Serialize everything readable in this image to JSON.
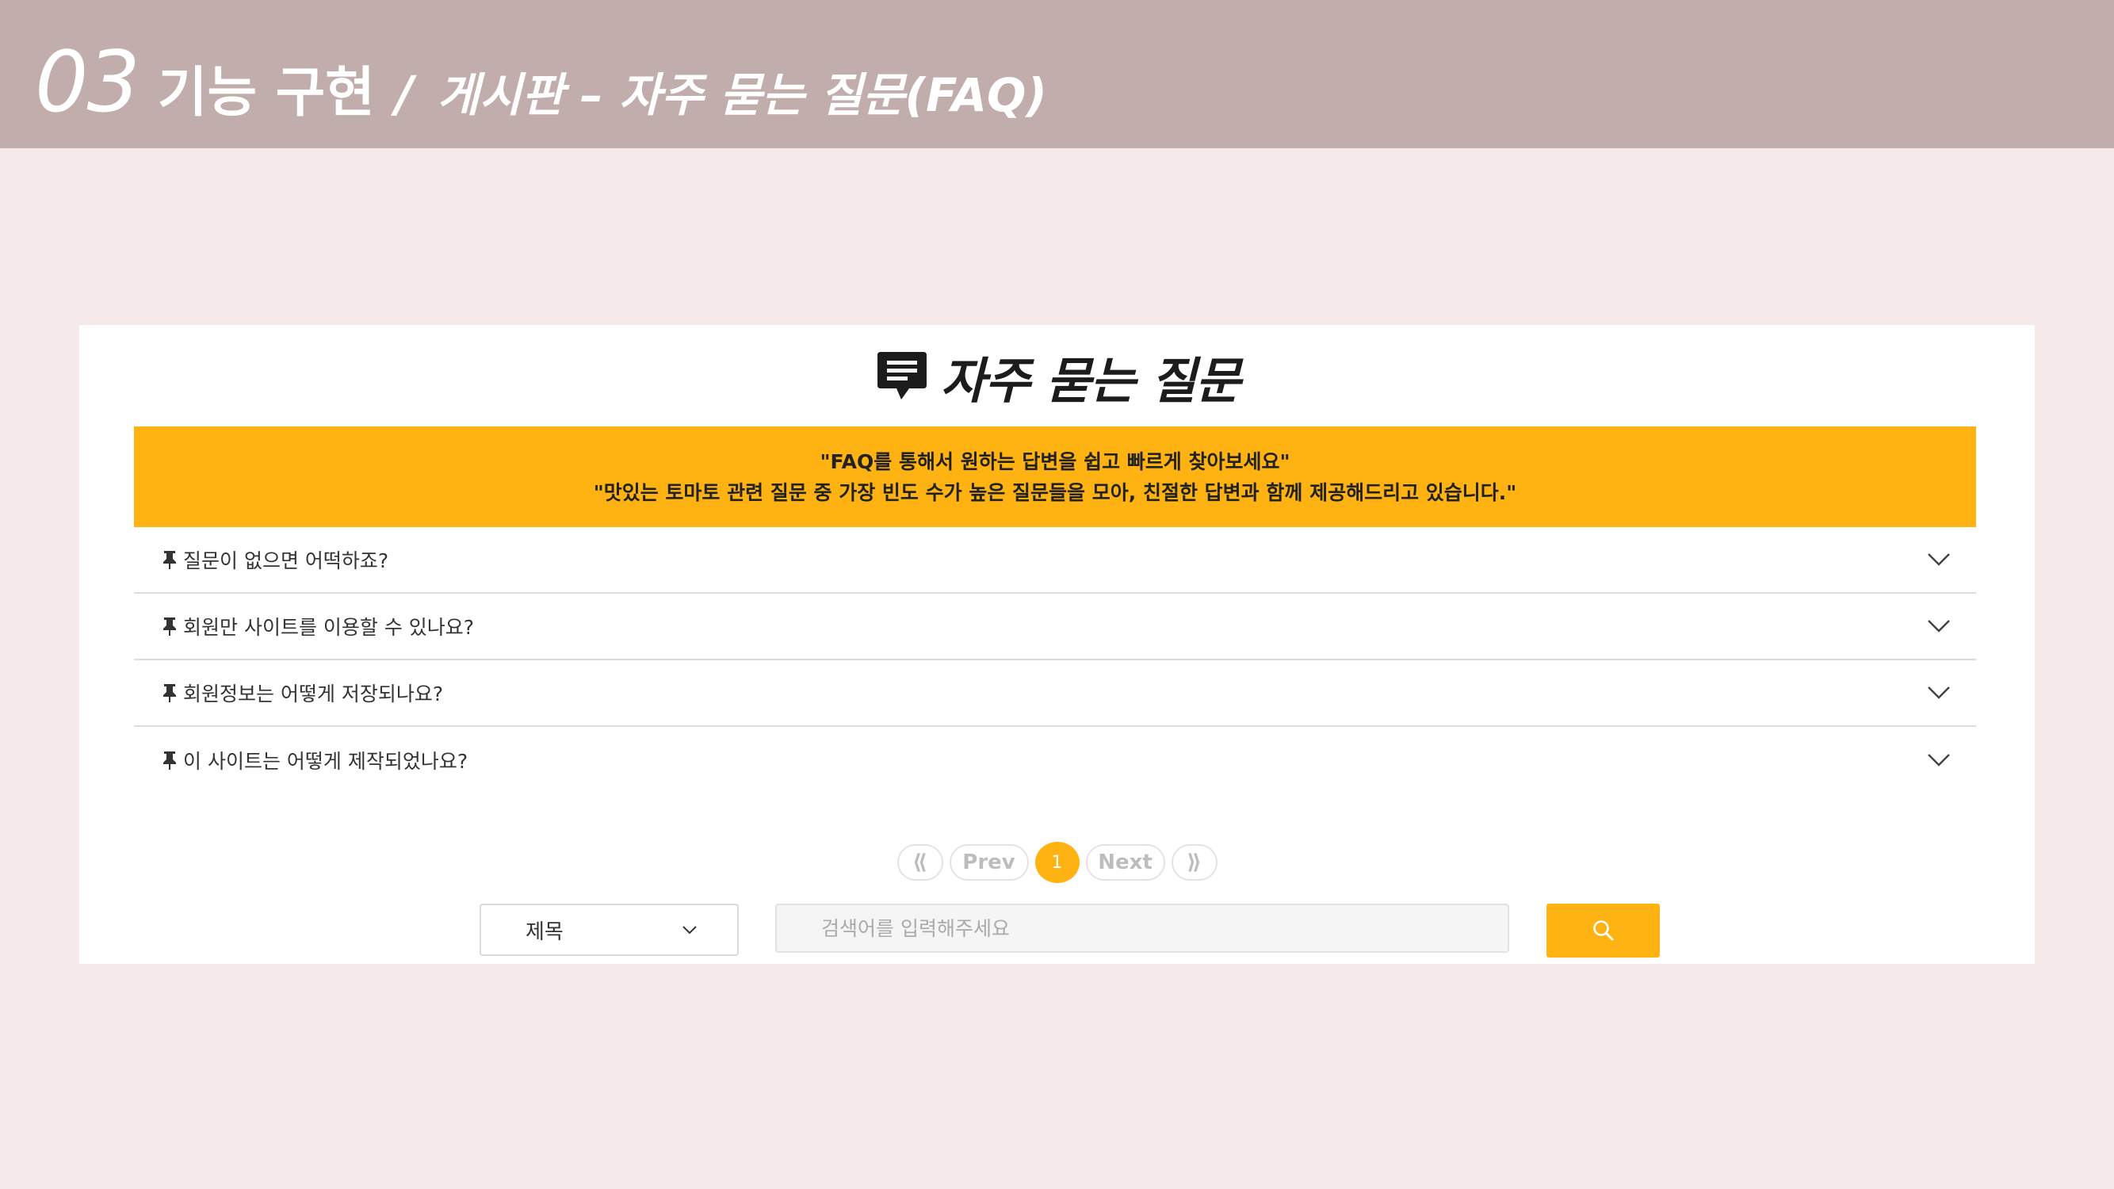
{
  "header": {
    "section_number": "03",
    "section_title": "기능 구현",
    "separator": "/",
    "subtitle": "게시판 – 자주 묻는 질문(FAQ)"
  },
  "faq": {
    "title": "자주 묻는 질문",
    "banner_line1": "\"FAQ를 통해서 원하는 답변을 쉽고 빠르게 찾아보세요\"",
    "banner_line2": "\"맛있는 토마토 관련 질문 중 가장 빈도 수가 높은 질문들을 모아, 친절한 답변과 함께 제공해드리고 있습니다.\"",
    "items": [
      {
        "question": "질문이 없으면 어떡하죠?"
      },
      {
        "question": "회원만 사이트를 이용할 수 있나요?"
      },
      {
        "question": "회원정보는 어떻게 저장되나요?"
      },
      {
        "question": "이 사이트는 어떻게 제작되었나요?"
      }
    ]
  },
  "pagination": {
    "first": "⟪",
    "prev": "Prev",
    "current": "1",
    "next": "Next",
    "last": "⟫"
  },
  "search": {
    "select_value": "제목",
    "placeholder": "검색어를 입력해주세요"
  },
  "colors": {
    "accent": "#ffb312",
    "header_bg": "#c1adab",
    "page_bg": "#f5eae9"
  }
}
